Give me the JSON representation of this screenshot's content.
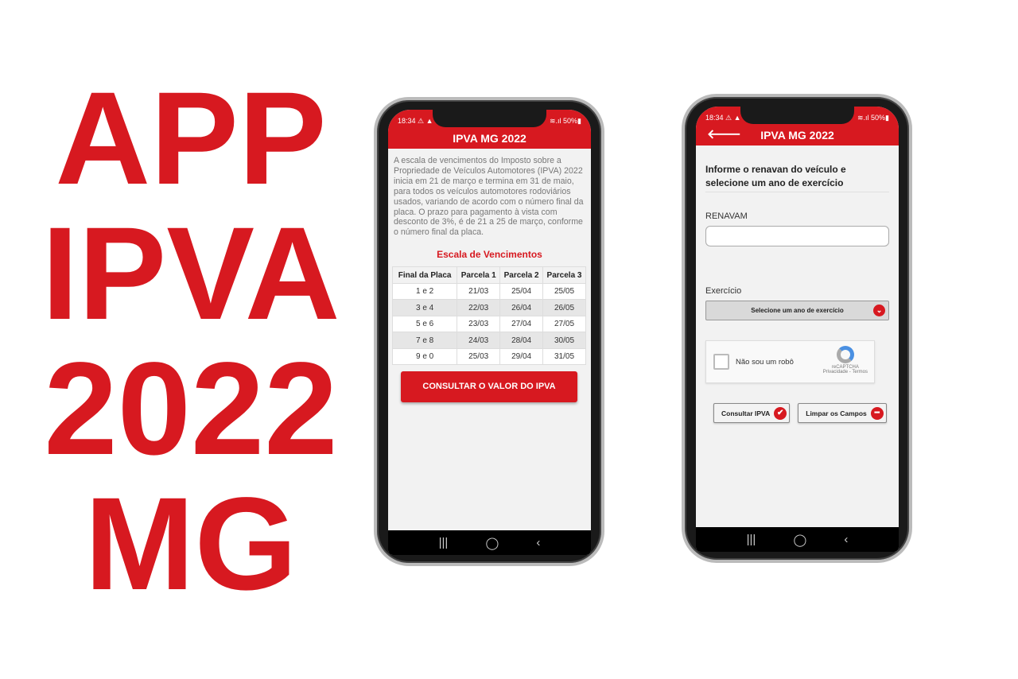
{
  "title_lines": [
    "APP",
    "IPVA",
    "2022",
    "MG"
  ],
  "status": {
    "time": "18:34 ⚠ ▲",
    "right": "≋.ıl 50%▮"
  },
  "screen1": {
    "header": "IPVA MG 2022",
    "intro": "A escala de vencimentos do Imposto sobre a Propriedade de Veículos Automotores (IPVA) 2022 inicia em 21 de março e termina em 31 de maio, para todos os veículos automotores rodoviários usados, variando de acordo com o número final da placa. O prazo para pagamento à vista com desconto de 3%, é de 21 a 25 de março, conforme o número final da placa.",
    "subtitle": "Escala de Vencimentos",
    "columns": [
      "Final da Placa",
      "Parcela 1",
      "Parcela 2",
      "Parcela 3"
    ],
    "rows": [
      [
        "1 e 2",
        "21/03",
        "25/04",
        "25/05"
      ],
      [
        "3 e 4",
        "22/03",
        "26/04",
        "26/05"
      ],
      [
        "5 e 6",
        "23/03",
        "27/04",
        "27/05"
      ],
      [
        "7 e 8",
        "24/03",
        "28/04",
        "30/05"
      ],
      [
        "9 e 0",
        "25/03",
        "29/04",
        "31/05"
      ]
    ],
    "button": "CONSULTAR O VALOR DO IPVA"
  },
  "screen2": {
    "header": "IPVA MG 2022",
    "title": "Informe o renavan do veículo e selecione um ano de exercício",
    "renavam_label": "RENAVAM",
    "renavam_value": "",
    "exercicio_label": "Exercício",
    "select_value": "Selecione um ano de exercício",
    "captcha_label": "Não sou um robô",
    "captcha_brand": "reCAPTCHA",
    "captcha_links": "Privacidade - Termos",
    "consultar": "Consultar IPVA",
    "limpar": "Limpar os Campos"
  },
  "nav": {
    "recent": "|||",
    "home": "◯",
    "back": "‹"
  },
  "accent": "#d71920"
}
